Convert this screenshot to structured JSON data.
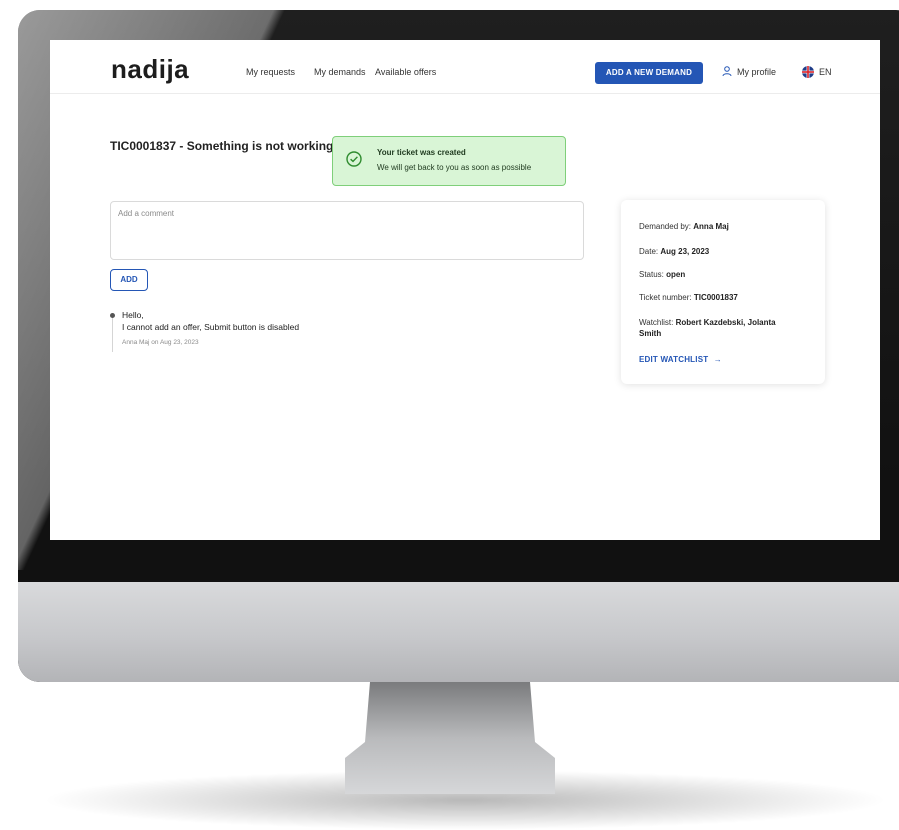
{
  "app": {
    "logo": "nadija"
  },
  "nav": {
    "links": [
      "My requests",
      "My demands",
      "Available offers"
    ],
    "add_demand_label": "ADD A NEW DEMAND",
    "profile_label": "My profile",
    "lang_label": "EN"
  },
  "ticket": {
    "title": "TIC0001837 - Something is not working"
  },
  "toast": {
    "title": "Your ticket was created",
    "message": "We will get back to you as soon as possible"
  },
  "comment": {
    "placeholder": "Add a comment",
    "add_label": "ADD"
  },
  "thread": {
    "line1": "Hello,",
    "line2": "I cannot add an offer, Submit button is disabled",
    "meta": "Anna Maj on Aug 23, 2023"
  },
  "info": {
    "demanded_by_label": "Demanded by: ",
    "demanded_by_value": "Anna Maj",
    "date_label": "Date: ",
    "date_value": "Aug 23, 2023",
    "status_label": "Status: ",
    "status_value": "open",
    "ticket_number_label": "Ticket number: ",
    "ticket_number_value": "TIC0001837",
    "watchlist_label": "Watchlist: ",
    "watchlist_value_1": "Robert Kazdebski, Jolanta",
    "watchlist_value_2": "Smith",
    "edit_watchlist_label": "EDIT WATCHLIST",
    "arrow": "→"
  },
  "colors": {
    "accent": "#2456b5",
    "success_bg": "#d9f5d6",
    "success_border": "#7fcf7a"
  },
  "icons": {
    "profile": "person-icon",
    "lang": "uk-flag-icon",
    "toast": "check-circle-icon"
  }
}
